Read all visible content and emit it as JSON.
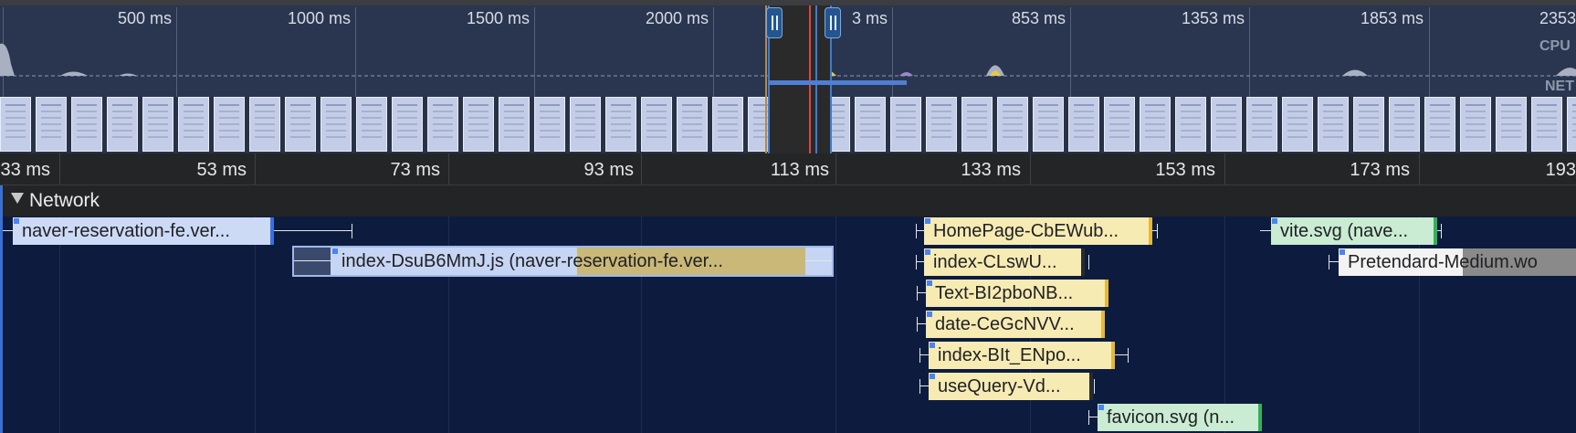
{
  "overview": {
    "tick_labels": [
      "500 ms",
      "1000 ms",
      "1500 ms",
      "2000 ms",
      "3 ms",
      "853 ms",
      "1353 ms",
      "1853 ms",
      "2353"
    ],
    "side_labels": [
      "CPU",
      "NET"
    ]
  },
  "ruler": {
    "tick_labels": [
      "33 ms",
      "53 ms",
      "73 ms",
      "93 ms",
      "113 ms",
      "133 ms",
      "153 ms",
      "173 ms",
      "193"
    ]
  },
  "track": {
    "title": "Network",
    "requests": [
      {
        "label": "naver-reservation-fe.ver...",
        "type": "document"
      },
      {
        "label": "index-DsuB6MmJ.js (naver-reservation-fe.ver...",
        "type": "script"
      },
      {
        "label": "HomePage-CbEWub...",
        "type": "script"
      },
      {
        "label": "index-CLswU...",
        "type": "script"
      },
      {
        "label": "Text-BI2pboNB...",
        "type": "script"
      },
      {
        "label": "date-CeGcNVV...",
        "type": "script"
      },
      {
        "label": "index-BIt_ENpo...",
        "type": "script"
      },
      {
        "label": "useQuery-Vd...",
        "type": "script"
      },
      {
        "label": "favicon.svg (n...",
        "type": "image"
      },
      {
        "label": "vite.svg (nave...",
        "type": "image"
      },
      {
        "label": "Pretendard-Medium.wo",
        "type": "font"
      }
    ]
  },
  "colors": {
    "overview_bg": "#2a3650",
    "lane_bg": "#0d1c3e",
    "document": "#cddaf6",
    "script": "#f7ebb4",
    "image": "#c9ecd2",
    "font": "#f3f3f3",
    "selection": "#3c7bd4",
    "marker_red": "#e04545"
  },
  "icons": {
    "selection_handle": "grip-handle-icon",
    "collapse": "triangle-down-icon"
  }
}
